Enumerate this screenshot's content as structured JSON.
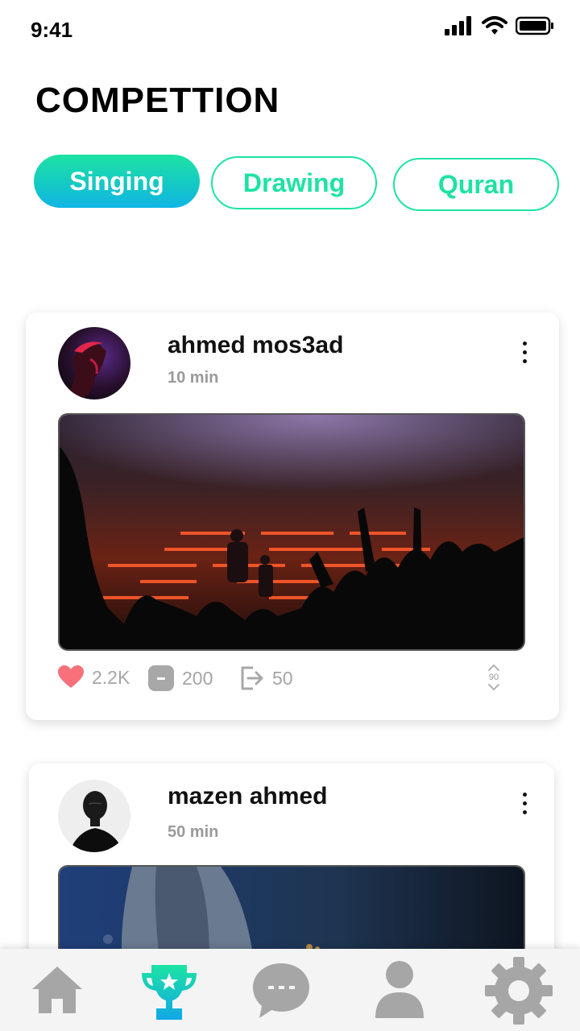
{
  "status_bar": {
    "time": "9:41"
  },
  "page": {
    "title": "COMPETTION"
  },
  "categories": [
    {
      "label": "Singing",
      "active": true
    },
    {
      "label": "Drawing",
      "active": false
    },
    {
      "label": "Quran",
      "active": false
    }
  ],
  "posts": [
    {
      "user_name": "ahmed mos3ad",
      "time_ago": "10 min",
      "likes": "2.2K",
      "comments": "200",
      "shares": "50",
      "votes": "90"
    },
    {
      "user_name": "mazen ahmed",
      "time_ago": "50 min"
    }
  ],
  "bottom_nav": {
    "items": [
      "home-icon",
      "trophy-icon",
      "chat-icon",
      "profile-icon",
      "settings-icon"
    ],
    "active": "trophy-icon"
  },
  "colors": {
    "accent": "#1de3a3",
    "accent_blue": "#10b5e6",
    "like": "#f7707a",
    "muted": "#a5a5a5",
    "nav_icon": "#a6a6a6"
  }
}
